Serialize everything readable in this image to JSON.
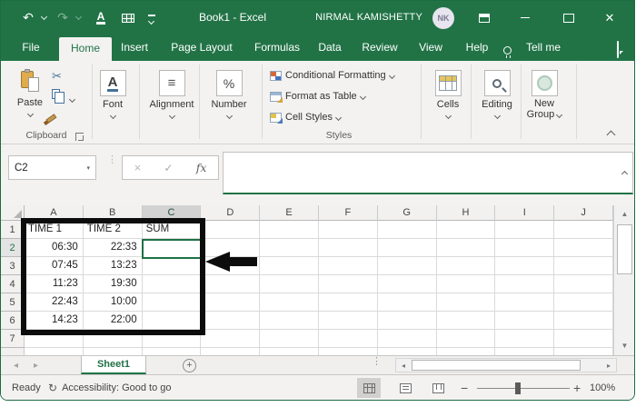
{
  "titlebar": {
    "title": "Book1 - Excel",
    "user_name": "NIRMAL KAMISHETTY",
    "user_initials": "NK"
  },
  "icons": {
    "undo": "↶",
    "redo": "↷",
    "scissors": "✂",
    "cancel": "×",
    "enter": "✓",
    "fx": "fx",
    "font_letter": "A",
    "alignment_lines": "≡",
    "percent": "%",
    "minus": "−",
    "plus": "+",
    "dots_v": "⋮",
    "tri_up": "▲",
    "tri_down": "▼",
    "tri_left": "◂",
    "tri_right": "▸",
    "accessibility": "↻",
    "dropdown": "▾"
  },
  "tabs": [
    {
      "label": "File",
      "active": false
    },
    {
      "label": "Home",
      "active": true
    },
    {
      "label": "Insert",
      "active": false
    },
    {
      "label": "Page Layout",
      "active": false
    },
    {
      "label": "Formulas",
      "active": false
    },
    {
      "label": "Data",
      "active": false
    },
    {
      "label": "Review",
      "active": false
    },
    {
      "label": "View",
      "active": false
    },
    {
      "label": "Help",
      "active": false
    }
  ],
  "tell_me_label": "Tell me",
  "ribbon": {
    "paste_label": "Paste",
    "clipboard_label": "Clipboard",
    "font_label": "Font",
    "alignment_label": "Alignment",
    "number_label": "Number",
    "styles_items": [
      "Conditional Formatting",
      "Format as Table",
      "Cell Styles"
    ],
    "styles_label": "Styles",
    "cells_label": "Cells",
    "editing_label": "Editing",
    "new_group_line1": "New",
    "new_group_line2": "Group"
  },
  "formula_bar": {
    "name_box": "C2",
    "formula": ""
  },
  "sheet": {
    "columns": [
      "A",
      "B",
      "C",
      "D",
      "E",
      "F",
      "G",
      "H",
      "I",
      "J"
    ],
    "selected_cell": "C2",
    "selected_column": "C",
    "selected_row": "2",
    "rows": [
      {
        "num": "1",
        "header": true,
        "cells": {
          "A": "TIME 1",
          "B": "TIME 2",
          "C": "SUM"
        }
      },
      {
        "num": "2",
        "cells": {
          "A": "06:30",
          "B": "22:33",
          "C": ""
        }
      },
      {
        "num": "3",
        "cells": {
          "A": "07:45",
          "B": "13:23",
          "C": ""
        }
      },
      {
        "num": "4",
        "cells": {
          "A": "11:23",
          "B": "19:30",
          "C": ""
        }
      },
      {
        "num": "5",
        "cells": {
          "A": "22:43",
          "B": "10:00",
          "C": ""
        }
      },
      {
        "num": "6",
        "cells": {
          "A": "14:23",
          "B": "22:00",
          "C": ""
        }
      },
      {
        "num": "7",
        "cells": {}
      },
      {
        "num": "",
        "cells": {}
      }
    ],
    "annotations": {
      "highlight_range": "A1:C6",
      "arrow_points_to": "C2"
    }
  },
  "sheet_tabs": {
    "active_sheet": "Sheet1"
  },
  "status_bar": {
    "mode": "Ready",
    "accessibility": "Accessibility: Good to go",
    "zoom_level": "100%"
  },
  "colors": {
    "brand_green": "#217346",
    "selection_green": "#1e7145",
    "annotation_black": "#0c0c0c",
    "ribbon_bg": "#f3f2f1"
  }
}
